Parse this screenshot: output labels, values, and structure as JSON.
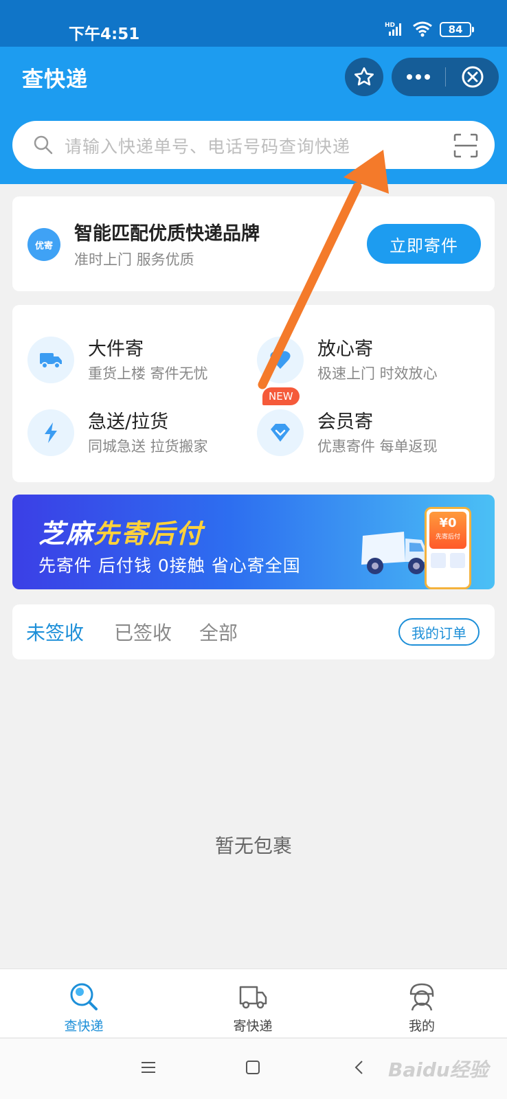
{
  "status_bar": {
    "time": "下午4:51",
    "network": "HD",
    "battery": "84"
  },
  "header": {
    "title": "查快递"
  },
  "search": {
    "placeholder": "请输入快递单号、电话号码查询快递"
  },
  "promo": {
    "badge": "优寄",
    "heading": "智能匹配优质快递品牌",
    "subtitle": "准时上门 服务优质",
    "button": "立即寄件"
  },
  "services": [
    {
      "title": "大件寄",
      "desc": "重货上楼 寄件无忧",
      "icon": "truck-icon"
    },
    {
      "title": "放心寄",
      "desc": "极速上门 时效放心",
      "icon": "heart-icon"
    },
    {
      "title": "急送/拉货",
      "desc": "同城急送 拉货搬家",
      "icon": "lightning-icon"
    },
    {
      "title": "会员寄",
      "desc": "优惠寄件 每单返现",
      "icon": "diamond-icon",
      "badge": "NEW"
    }
  ],
  "banner": {
    "title_part1": "芝麻",
    "title_part2": "先寄后付",
    "subtitle": "先寄件 后付钱 0接触 省心寄全国",
    "price": "¥0",
    "tag": "先寄后付"
  },
  "tabs": {
    "items": [
      "未签收",
      "已签收",
      "全部"
    ],
    "active": 0,
    "my_orders": "我的订单"
  },
  "empty_state": "暂无包裹",
  "bottom_nav": [
    {
      "label": "查快递",
      "icon": "search-package-icon",
      "active": true
    },
    {
      "label": "寄快递",
      "icon": "delivery-truck-icon",
      "active": false
    },
    {
      "label": "我的",
      "icon": "profile-icon",
      "active": false
    }
  ],
  "watermark": "Baidu经验",
  "colors": {
    "primary": "#1d9cf0",
    "status_bar": "#1075c8",
    "accent_text": "#1d8fd8",
    "arrow": "#f47a2a",
    "new_badge": "#f55a3a"
  }
}
